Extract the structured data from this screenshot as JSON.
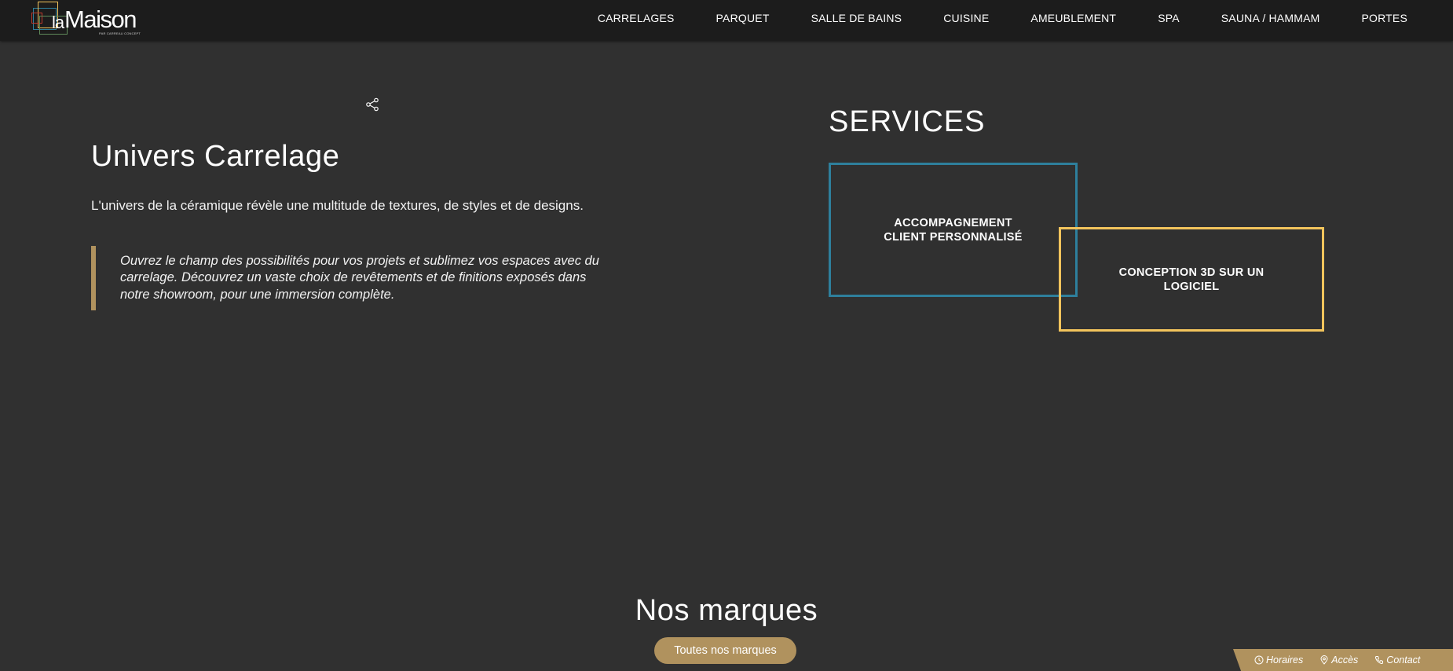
{
  "header": {
    "logo": {
      "la": "la",
      "maison": "Maison",
      "sub": "PAR CARREAU CONCEPT",
      "colors": [
        "#2e7f9c",
        "#f2c45c",
        "#c0392b",
        "#5f8a5a"
      ]
    },
    "nav": [
      {
        "label": "CARRELAGES"
      },
      {
        "label": "PARQUET"
      },
      {
        "label": "SALLE DE BAINS"
      },
      {
        "label": "CUISINE"
      },
      {
        "label": "AMEUBLEMENT"
      },
      {
        "label": "SPA"
      },
      {
        "label": "SAUNA / HAMMAM"
      },
      {
        "label": "PORTES"
      }
    ]
  },
  "main": {
    "share_icon": "share-icon",
    "title": "Univers Carrelage",
    "intro": "L'univers de la céramique révèle une multitude de textures, de styles et de designs.",
    "quote": "Ouvrez le champ des possibilités pour vos projets et sublimez vos espaces avec du carrelage. Découvrez un vaste choix de revêtements et de finitions exposés dans notre showroom, pour une immersion complète."
  },
  "services": {
    "title": "SERVICES",
    "items": [
      {
        "label": "ACCOMPAGNEMENT CLIENT PERSONNALISÉ",
        "color": "#2e7f9c"
      },
      {
        "label": "CONCEPTION 3D SUR UN LOGICIEL",
        "color": "#f2c45c"
      }
    ]
  },
  "brands": {
    "title": "Nos marques",
    "button_label": "Toutes nos marques"
  },
  "bottom_bar": {
    "links": [
      {
        "label": "Horaires",
        "icon": "clock-icon"
      },
      {
        "label": "Accès",
        "icon": "location-pin-icon"
      },
      {
        "label": "Contact",
        "icon": "phone-icon"
      }
    ]
  },
  "colors": {
    "background": "#303030",
    "header": "#1c1c1c",
    "accent_gold": "#b0925e",
    "service_blue": "#2e7f9c",
    "service_yellow": "#f2c45c"
  }
}
